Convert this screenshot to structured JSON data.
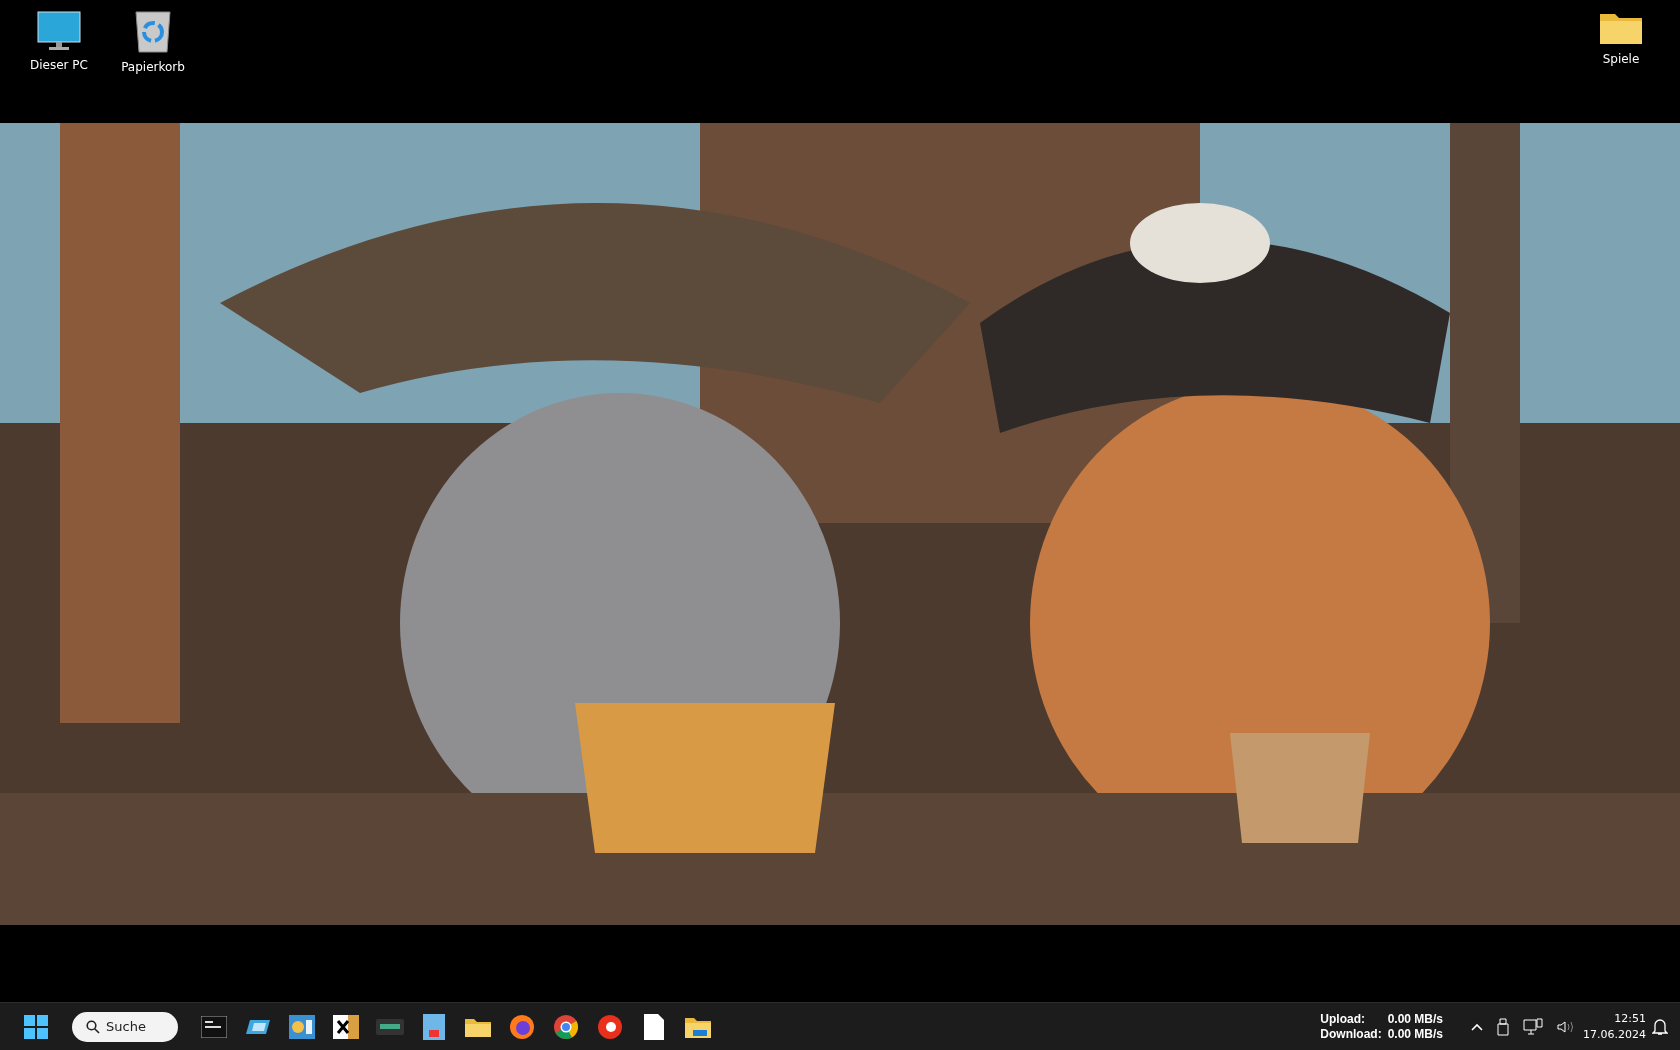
{
  "desktop_icons_left": [
    {
      "label": "Dieser PC",
      "kind": "monitor"
    },
    {
      "label": "Papierkorb",
      "kind": "bin"
    }
  ],
  "desktop_icons_right": [
    {
      "label": "Spiele",
      "kind": "folder"
    }
  ],
  "taskbar": {
    "search": {
      "label": "Suche"
    },
    "network": {
      "upload_label": "Upload:",
      "upload_value": "0.00 MB/s",
      "download_label": "Download:",
      "download_value": "0.00 MB/s"
    },
    "clock": {
      "time": "12:51",
      "date": "17.06.2024"
    }
  }
}
